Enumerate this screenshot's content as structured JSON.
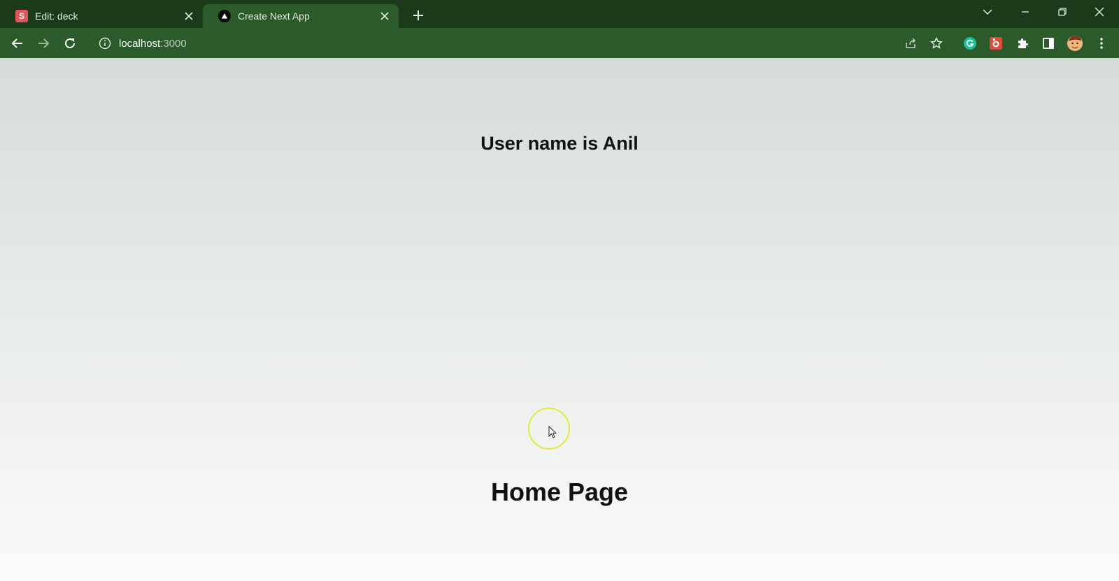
{
  "browser": {
    "tabs": [
      {
        "title": "Edit: deck",
        "favicon": "s-letter-icon",
        "favicon_letter": "S",
        "active": false
      },
      {
        "title": "Create Next App",
        "favicon": "nextjs-triangle-icon",
        "active": true
      }
    ],
    "address": {
      "host": "localhost",
      "port": ":3000"
    },
    "colors": {
      "frame": "#1a3a1a",
      "toolbar": "#2b5a2b"
    }
  },
  "page": {
    "heading_user": "User name is Anil",
    "heading_home": "Home Page"
  }
}
